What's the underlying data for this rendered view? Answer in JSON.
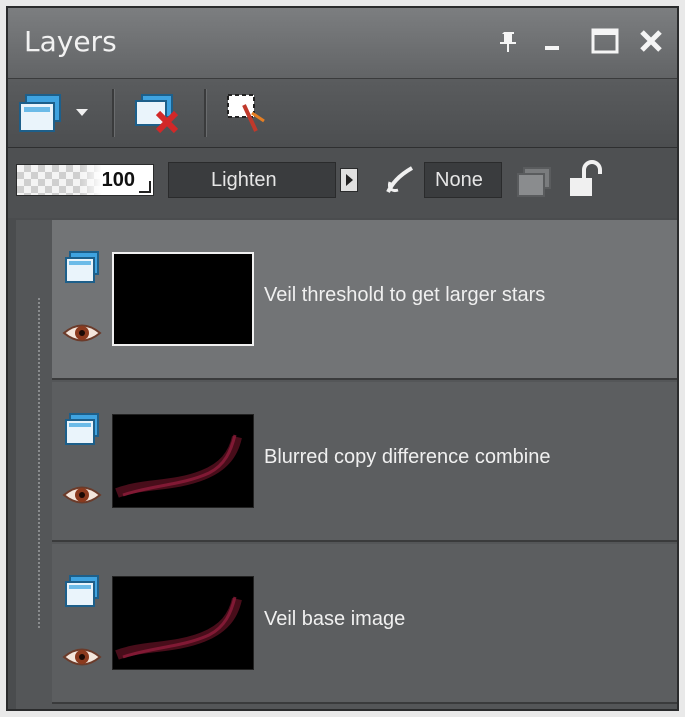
{
  "window": {
    "title": "Layers",
    "controls": [
      "pin-icon",
      "minimize-icon",
      "maximize-icon",
      "close-icon"
    ]
  },
  "toolbar": {
    "tools": [
      "new-raster-layer-icon",
      "dropdown-arrow-icon",
      "delete-layer-icon",
      "edit-selection-icon"
    ]
  },
  "properties": {
    "opacity": "100",
    "opacity_fraction": 1.0,
    "blend_mode": "Lighten",
    "layer_group_link": "None",
    "icons": [
      "link-icon",
      "mask-icon",
      "lock-icon"
    ]
  },
  "layers": [
    {
      "name": "Veil threshold to get larger stars",
      "selected": true,
      "thumbnail": "black"
    },
    {
      "name": "Blurred copy difference combine",
      "selected": false,
      "thumbnail": "dark-red-streak"
    },
    {
      "name": "Veil base image",
      "selected": false,
      "thumbnail": "dark-red-streak"
    }
  ],
  "colors": {
    "panel_bg": "#4a4c4e",
    "selected_row": "#727476",
    "row": "#5c5e60",
    "text": "#f0f0f0"
  }
}
